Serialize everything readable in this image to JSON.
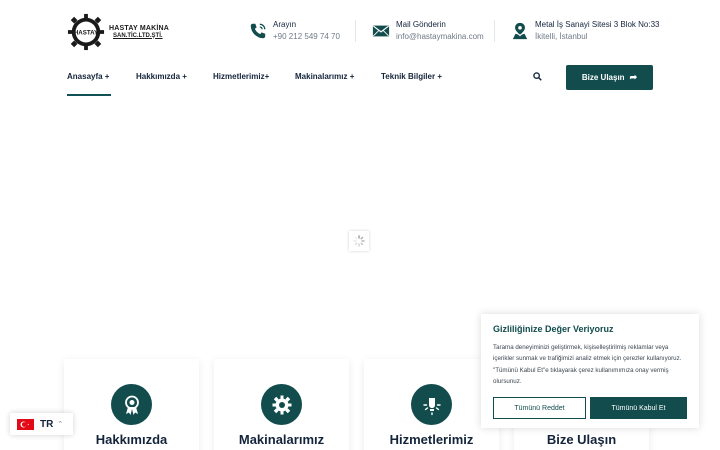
{
  "logo": {
    "line1": "HASTAY MAKİNA",
    "line2": "SAN.TİC.LTD.ŞTİ.",
    "badge": "HASTAY"
  },
  "contacts": [
    {
      "icon": "phone-icon",
      "label": "Arayın",
      "value": "+90 212 549 74 70"
    },
    {
      "icon": "mail-icon",
      "label": "Mail Gönderin",
      "value": "info@hastaymakina.com"
    },
    {
      "icon": "map-pin-icon",
      "label": "Metal İş Sanayi Sitesi 3 Blok No:33",
      "value": "İkitelli, İstanbul"
    }
  ],
  "nav": [
    {
      "label": "Anasayfa +",
      "active": true
    },
    {
      "label": "Hakkımızda +"
    },
    {
      "label": "Hizmetlerimiz+"
    },
    {
      "label": "Makinalarımız +"
    },
    {
      "label": "Teknik Bilgiler +"
    }
  ],
  "cta": {
    "label": "Bize Ulaşın"
  },
  "cards": [
    {
      "title": "Hakkımızda",
      "icon": "award-icon"
    },
    {
      "title": "Makinalarımız",
      "icon": "gear-icon"
    },
    {
      "title": "Hizmetlerimiz",
      "icon": "lightbulb-icon"
    },
    {
      "title": "Bize Ulaşın",
      "icon": "contact-icon"
    }
  ],
  "cookie": {
    "title": "Gizliliğinize Değer Veriyoruz",
    "body": "Tarama deneyiminizi geliştirmek, kişiselleştirilmiş reklamlar veya içerikler sunmak ve trafiğimizi analiz etmek için çerezler kullanıyoruz. \"Tümünü Kabul Et\"e tıklayarak çerez kullanımımıza onay vermiş olursunuz.",
    "reject_label": "Tümünü Reddet",
    "accept_label": "Tümünü Kabul Et"
  },
  "language": {
    "code": "TR",
    "icon": "turkey-flag-icon"
  },
  "colors": {
    "primary": "#124c4d",
    "text": "#14243b",
    "muted": "#707a86"
  }
}
